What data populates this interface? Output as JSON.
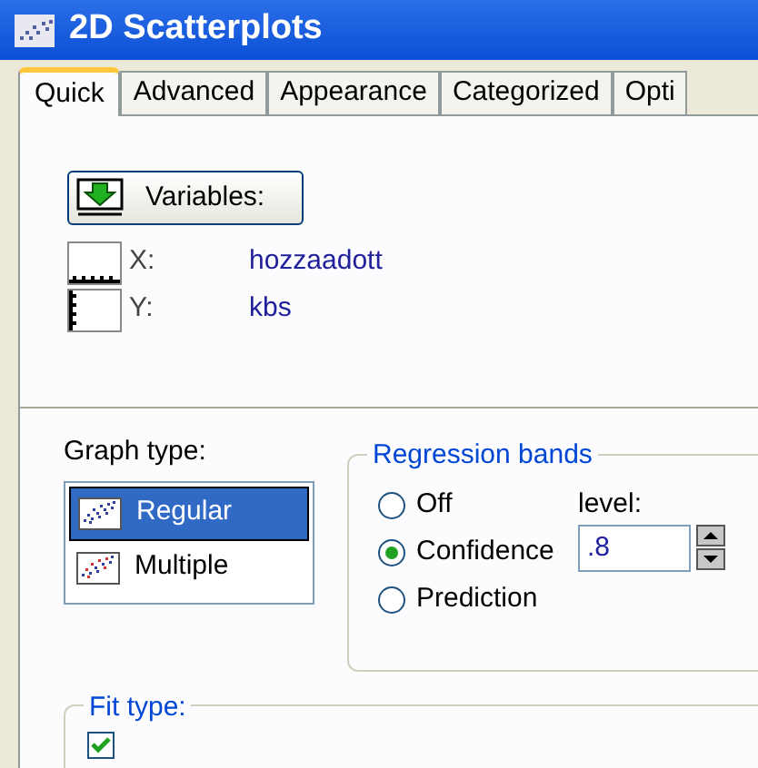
{
  "window": {
    "title": "2D Scatterplots"
  },
  "tabs": [
    {
      "label": "Quick",
      "selected": true
    },
    {
      "label": "Advanced",
      "selected": false
    },
    {
      "label": "Appearance",
      "selected": false
    },
    {
      "label": "Categorized",
      "selected": false
    },
    {
      "label": "Opti",
      "selected": false
    }
  ],
  "variables_button": "Variables:",
  "variables": [
    {
      "axis": "X:",
      "value": "hozzaadott",
      "kind": "x"
    },
    {
      "axis": "Y:",
      "value": "kbs",
      "kind": "y"
    }
  ],
  "graph_type": {
    "label": "Graph type:",
    "items": [
      {
        "label": "Regular",
        "selected": true
      },
      {
        "label": "Multiple",
        "selected": false
      }
    ]
  },
  "regression_bands": {
    "title": "Regression bands",
    "options": [
      {
        "label": "Off",
        "selected": false
      },
      {
        "label": "Confidence",
        "selected": true
      },
      {
        "label": "Prediction",
        "selected": false
      }
    ],
    "level_label": "level:",
    "level_value": ".8"
  },
  "fit_type": {
    "title": "Fit type:",
    "checkbox": {
      "checked": true
    }
  }
}
